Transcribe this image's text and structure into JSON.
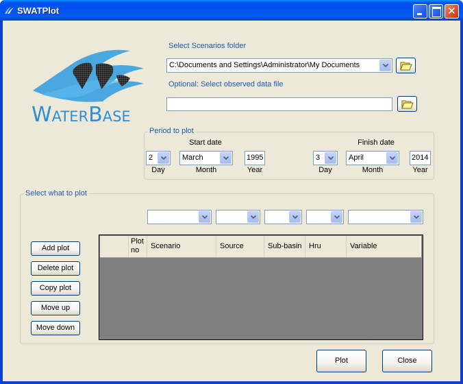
{
  "window": {
    "title": "SWATPlot",
    "controls": [
      "minimize",
      "maximize",
      "close"
    ]
  },
  "logo": {
    "text": "WaterBase",
    "brand_color": "#2d8fd5"
  },
  "scenarios": {
    "label": "Select Scenarios folder",
    "folder_value": "C:\\Documents and Settings\\Administrator\\My Documents",
    "browse_icon": "folder-open-icon"
  },
  "observed": {
    "label": "Optional: Select observed data file",
    "file_value": "",
    "browse_icon": "folder-open-icon"
  },
  "period": {
    "group_label": "Period to plot",
    "start": {
      "heading": "Start date",
      "day": "2",
      "month": "March",
      "year": "1995",
      "day_label": "Day",
      "month_label": "Month",
      "year_label": "Year"
    },
    "finish": {
      "heading": "Finish date",
      "day": "3",
      "month": "April",
      "year": "2014",
      "day_label": "Day",
      "month_label": "Month",
      "year_label": "Year"
    }
  },
  "select_plot": {
    "group_label": "Select what to plot",
    "filters": {
      "scenario": "",
      "source": "",
      "subbasin": "",
      "hru": "",
      "variable": ""
    },
    "buttons": {
      "add": "Add plot",
      "delete": "Delete plot",
      "copy": "Copy plot",
      "move_up": "Move up",
      "move_down": "Move down"
    },
    "grid": {
      "columns": [
        "",
        "Plot\nno",
        "Scenario",
        "Source",
        "Sub-basin",
        "Hru",
        "Variable"
      ],
      "rows": []
    }
  },
  "footer": {
    "plot": "Plot",
    "close": "Close"
  }
}
